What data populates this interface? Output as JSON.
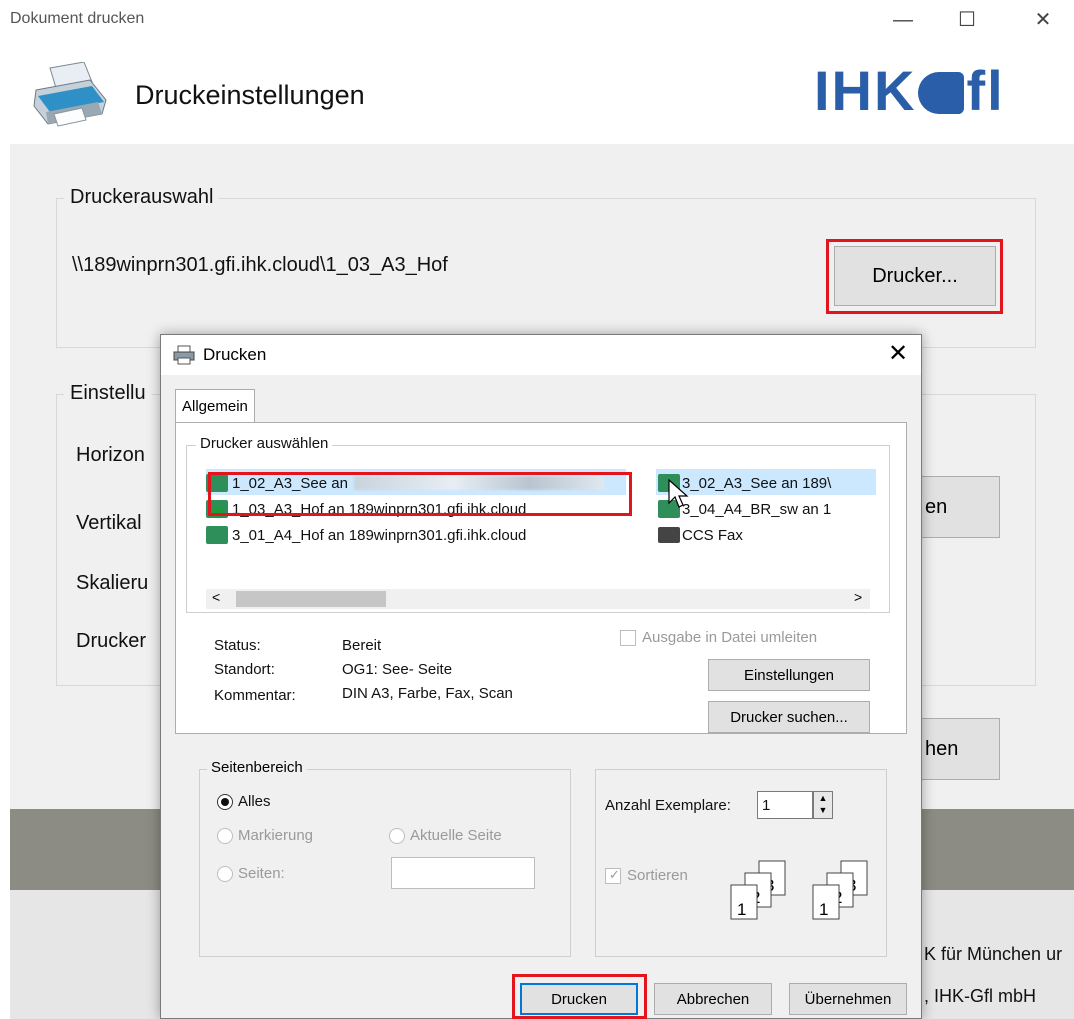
{
  "window": {
    "title": "Dokument drucken",
    "header_title": "Druckeinstellungen",
    "logo_text": "IHK",
    "logo_text_2": "fl",
    "logo_color": "#2a5ea8"
  },
  "printer_selection": {
    "group_label": "Druckerauswahl",
    "current_printer": "\\\\189winprn301.gfi.ihk.cloud\\1_03_A3_Hof",
    "printer_button": "Drucker..."
  },
  "settings": {
    "group_label": "Einstellu",
    "rows": [
      "Horizon",
      "Vertikal",
      "Skalieru",
      "Drucker"
    ],
    "button_1_partial": "en",
    "button_2_partial": "hen"
  },
  "footer": {
    "line_1": "K für München ur",
    "line_2": ", IHK-Gfl mbH"
  },
  "dialog": {
    "title": "Drucken",
    "tab": "Allgemein",
    "printer_group_label": "Drucker auswählen",
    "printers_left": [
      "1_02_A3_See an",
      "1_03_A3_Hof an 189winprn301.gfi.ihk.cloud",
      "3_01_A4_Hof an 189winprn301.gfi.ihk.cloud"
    ],
    "printers_right": [
      "3_02_A3_See an 189\\",
      "3_04_A4_BR_sw an 1",
      "CCS Fax"
    ],
    "status_label": "Status:",
    "status_value": "Bereit",
    "location_label": "Standort:",
    "location_value": "OG1: See- Seite",
    "comment_label": "Kommentar:",
    "comment_value": "DIN A3, Farbe, Fax, Scan",
    "print_to_file": "Ausgabe in Datei umleiten",
    "settings_button": "Einstellungen",
    "find_printer_button": "Drucker suchen...",
    "page_range": {
      "label": "Seitenbereich",
      "all": "Alles",
      "selection": "Markierung",
      "current_page": "Aktuelle Seite",
      "pages": "Seiten:"
    },
    "copies": {
      "label": "Anzahl Exemplare:",
      "value": "1",
      "collate": "Sortieren"
    },
    "buttons": {
      "print": "Drucken",
      "cancel": "Abbrechen",
      "apply": "Übernehmen"
    }
  },
  "colors": {
    "highlight_red": "#e3141c",
    "selection_blue": "#cce8ff",
    "accent_blue": "#0078d7"
  }
}
